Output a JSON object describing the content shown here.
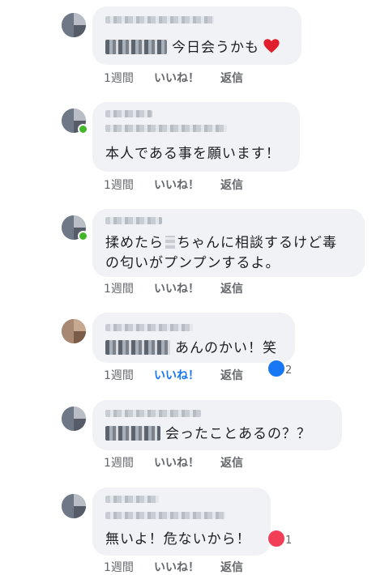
{
  "comments": [
    {
      "text": "今日会うかも",
      "time": "1週間",
      "like": "いいね！",
      "reply": "返信",
      "emoji": "heart-emoji"
    },
    {
      "text": "本人である事を願います！",
      "time": "1週間",
      "like": "いいね！",
      "reply": "返信"
    },
    {
      "line1_a": "揉めたら",
      "line1_b": "ちゃんに相談するけど毒",
      "line2": "の匂いがプンプンするよ。",
      "time": "1週間",
      "like": "いいね！",
      "reply": "返信"
    },
    {
      "text": "あんのかい！笑",
      "time": "1週間",
      "like": "いいね！",
      "reply": "返信",
      "reaction_icon": "like-reaction-icon",
      "reaction_count": "2"
    },
    {
      "text": "会ったことあるの？？",
      "time": "1週間",
      "like": "いいね！",
      "reply": "返信"
    },
    {
      "text": "無いよ！危ないから！",
      "time": "1週間",
      "like": "いいね！",
      "reply": "返信",
      "reaction_icon": "love-reaction-icon",
      "reaction_count": "1"
    }
  ],
  "colors": {
    "bubble": "#f0f2f5",
    "like_active": "#1877f2",
    "love": "#f33e58",
    "online": "#42b72a",
    "secondary_text": "#65676b"
  }
}
